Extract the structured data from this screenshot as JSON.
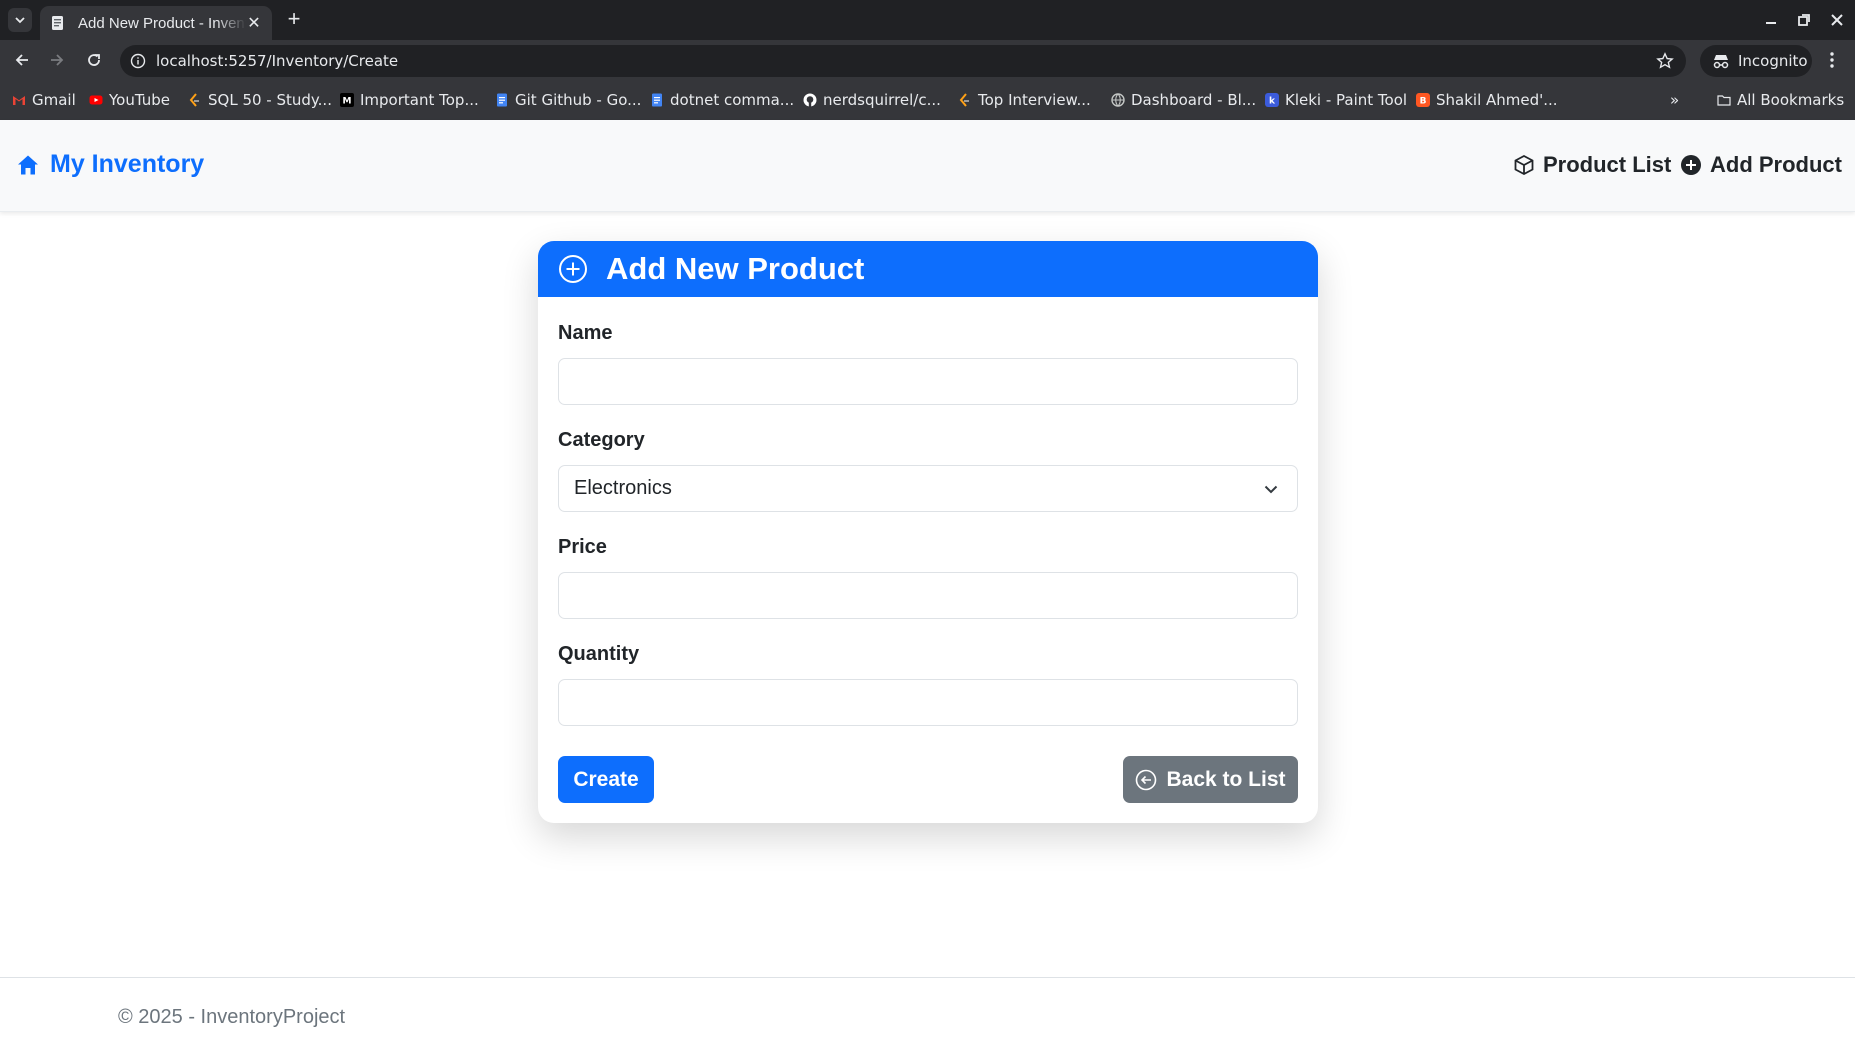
{
  "browser": {
    "tab_title": "Add New Product - InventoryProject",
    "url": "localhost:5257/Inventory/Create",
    "profile_label": "Incognito",
    "bookmarks": [
      {
        "label": "Gmail",
        "icon": "gmail-icon",
        "color": "#ea4335"
      },
      {
        "label": "YouTube",
        "icon": "youtube-icon",
        "color": "#ff0000"
      },
      {
        "label": "SQL 50 - Study...",
        "icon": "leetcode-icon",
        "color": "#ffa116"
      },
      {
        "label": "Important Top...",
        "icon": "medium-icon",
        "color": "#000000"
      },
      {
        "label": "Git Github - Go...",
        "icon": "docs-icon",
        "color": "#4285f4"
      },
      {
        "label": "dotnet comma...",
        "icon": "docs-icon",
        "color": "#4285f4"
      },
      {
        "label": "nerdsquirrel/c...",
        "icon": "github-icon",
        "color": "#ffffff"
      },
      {
        "label": "Top Interview...",
        "icon": "leetcode-icon",
        "color": "#ffa116"
      },
      {
        "label": "Dashboard - Bl...",
        "icon": "globe-icon",
        "color": "#9aa0a6"
      },
      {
        "label": "Kleki - Paint Tool",
        "icon": "kleki-icon",
        "color": "#3b5bdb"
      },
      {
        "label": "Shakil Ahmed'...",
        "icon": "blogger-icon",
        "color": "#ff5722"
      }
    ],
    "all_bookmarks_label": "All Bookmarks"
  },
  "navbar": {
    "brand": "My Inventory",
    "links": [
      "Product List",
      "Add Product"
    ]
  },
  "form": {
    "title": "Add New Product",
    "fields": {
      "name": {
        "label": "Name",
        "value": ""
      },
      "category": {
        "label": "Category",
        "value": "Electronics"
      },
      "price": {
        "label": "Price",
        "value": ""
      },
      "quantity": {
        "label": "Quantity",
        "value": ""
      }
    },
    "create_label": "Create",
    "back_label": "Back to List"
  },
  "footer": {
    "text": "© 2025 - InventoryProject"
  },
  "colors": {
    "primary": "#0d6efd",
    "secondary": "#6c757d",
    "navbar_bg": "#f8f9fa"
  }
}
